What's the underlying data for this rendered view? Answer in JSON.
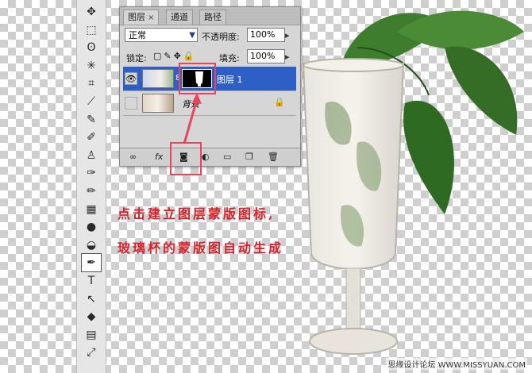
{
  "panel": {
    "tabs": [
      {
        "label": "图层",
        "close": "×"
      },
      {
        "label": "通道"
      },
      {
        "label": "路径"
      }
    ],
    "blend_mode": "正常",
    "opacity_label": "不透明度:",
    "opacity_value": "100%",
    "lock_label": "锁定:",
    "fill_label": "填充:",
    "fill_value": "100%",
    "layers": [
      {
        "name": "图层 1",
        "selected": true
      },
      {
        "name": "背景",
        "selected": false
      }
    ],
    "footer_icons": [
      "link-icon",
      "fx-icon",
      "add-mask-icon",
      "adjustment-icon",
      "folder-icon",
      "new-layer-icon",
      "trash-icon"
    ]
  },
  "annotation": {
    "line1": "点击建立图层蒙版图标,",
    "line2": "玻璃杯的蒙版图自动生成"
  },
  "watermark": "思缘设计论坛 WWW.MISSYUAN.COM",
  "colors": {
    "highlight": "#e6455b",
    "annotation": "#d8202a",
    "selection": "#2d5fc6"
  },
  "tools": [
    "move-icon",
    "marquee-icon",
    "lasso-icon",
    "magic-wand-icon",
    "crop-icon",
    "slice-icon",
    "healing-icon",
    "brush-icon",
    "clone-stamp-icon",
    "history-brush-icon",
    "eraser-icon",
    "gradient-icon",
    "blur-icon",
    "dodge-icon",
    "pen-icon",
    "type-icon",
    "path-select-icon",
    "shape-icon",
    "notes-icon",
    "eyedropper-icon"
  ],
  "tool_glyphs": [
    "✥",
    "⬚",
    "ʘ",
    "✳",
    "⌗",
    "⟋",
    "✎",
    "✐",
    "♙",
    "✑",
    "✏",
    "▦",
    "●",
    "◒",
    "✒",
    "T",
    "↖",
    "◆",
    "▤",
    "⤢"
  ]
}
